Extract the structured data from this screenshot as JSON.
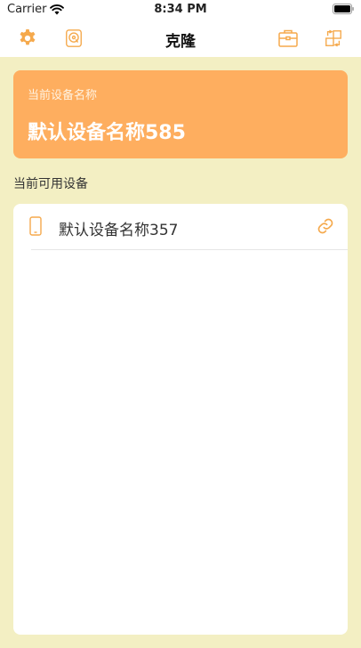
{
  "status_bar": {
    "carrier": "Carrier",
    "time": "8:34 PM",
    "icons": [
      "wifi-icon",
      "battery-icon"
    ]
  },
  "nav": {
    "title": "克隆",
    "left_icons": [
      "gear-icon",
      "storage-icon"
    ],
    "right_icons": [
      "briefcase-icon",
      "swap-icon"
    ]
  },
  "current_device": {
    "label": "当前设备名称",
    "name": "默认设备名称585"
  },
  "available": {
    "title": "当前可用设备",
    "devices": [
      {
        "name": "默认设备名称357",
        "icon": "phone-icon",
        "action_icon": "link-icon"
      }
    ]
  },
  "colors": {
    "accent": "#f5a94c",
    "card": "#feae5f",
    "background": "#f3efc3"
  }
}
